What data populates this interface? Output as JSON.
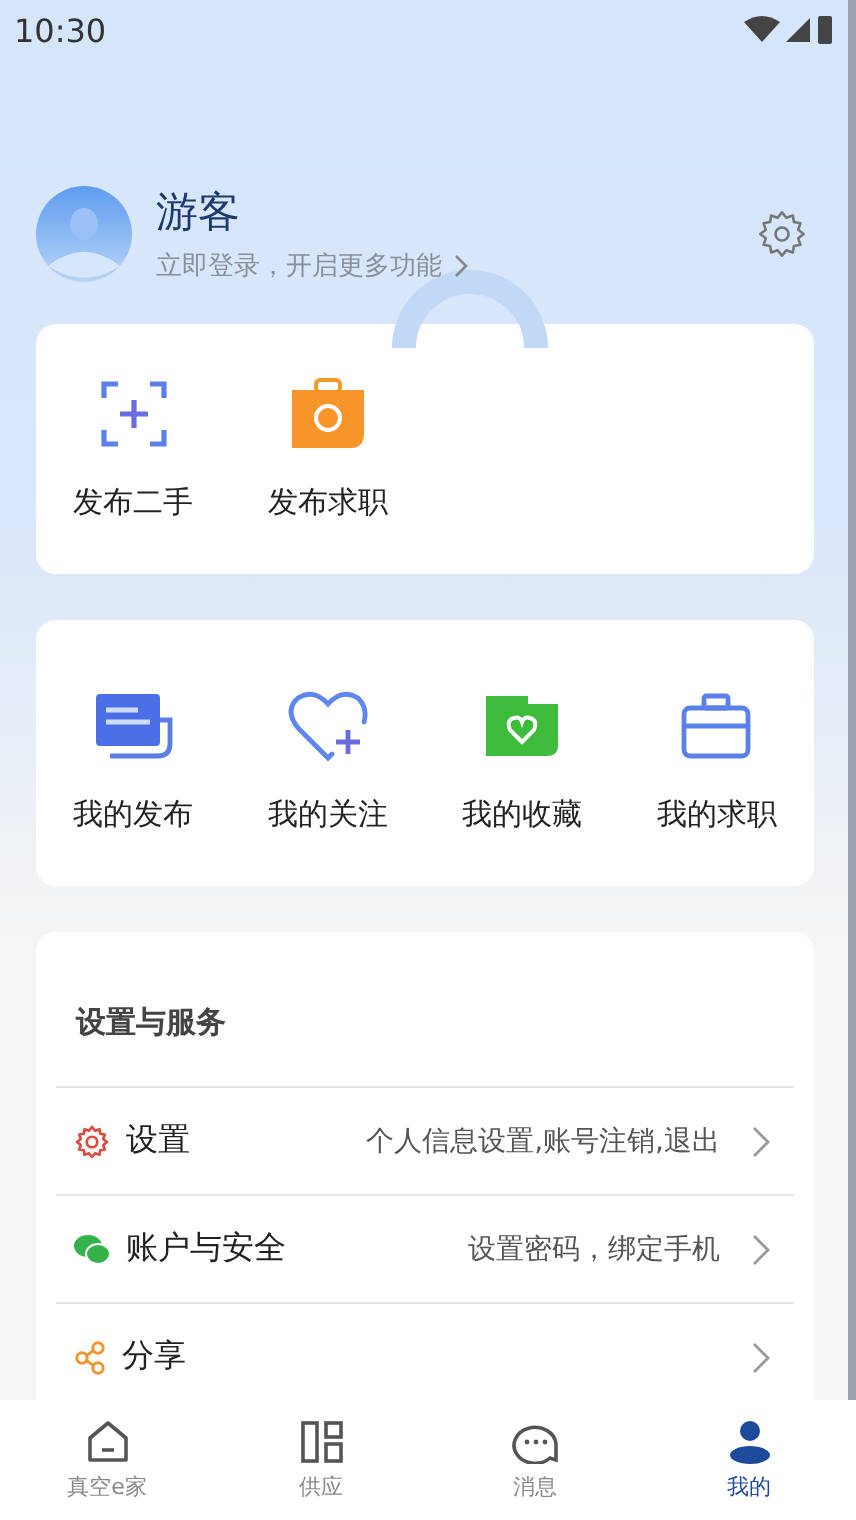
{
  "status_bar": {
    "time": "10:30"
  },
  "profile": {
    "name": "游客",
    "subtitle": "立即登录，开启更多功能"
  },
  "quick_actions": [
    {
      "label": "发布二手"
    },
    {
      "label": "发布求职"
    }
  ],
  "my_items": [
    {
      "label": "我的发布"
    },
    {
      "label": "我的关注"
    },
    {
      "label": "我的收藏"
    },
    {
      "label": "我的求职"
    }
  ],
  "services": {
    "title": "设置与服务",
    "items": [
      {
        "label": "设置",
        "detail": "个人信息设置,账号注销,退出"
      },
      {
        "label": "账户与安全",
        "detail": "设置密码，绑定手机"
      },
      {
        "label": "分享"
      }
    ]
  },
  "tabs": [
    {
      "label": "真空e家",
      "selected": false
    },
    {
      "label": "供应",
      "selected": false
    },
    {
      "label": "消息",
      "selected": false
    },
    {
      "label": "我的",
      "selected": true
    }
  ]
}
